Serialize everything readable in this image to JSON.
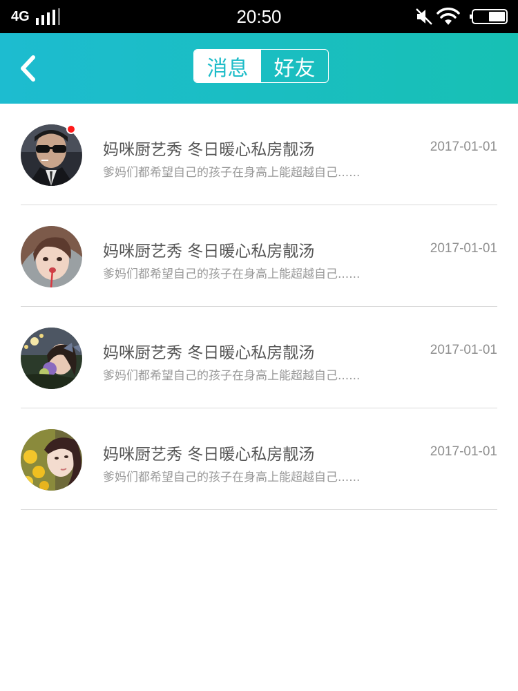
{
  "status_bar": {
    "network": "4G",
    "time": "20:50",
    "icons": [
      "signal-icon",
      "mute-icon",
      "wifi-icon",
      "battery-icon"
    ]
  },
  "header": {
    "back_icon": "chevron-left-icon",
    "tabs": [
      {
        "label": "消息",
        "active": true
      },
      {
        "label": "好友",
        "active": false
      }
    ]
  },
  "colors": {
    "header_start": "#1dbcd0",
    "header_end": "#17c0b4",
    "unread_dot": "#ff1a1a"
  },
  "messages": [
    {
      "title": "妈咪厨艺秀 冬日暖心私房靓汤",
      "date": "2017-01-01",
      "preview": "爹妈们都希望自己的孩子在身高上能超越自己......",
      "unread": true
    },
    {
      "title": "妈咪厨艺秀 冬日暖心私房靓汤",
      "date": "2017-01-01",
      "preview": "爹妈们都希望自己的孩子在身高上能超越自己......",
      "unread": false
    },
    {
      "title": "妈咪厨艺秀 冬日暖心私房靓汤",
      "date": "2017-01-01",
      "preview": "爹妈们都希望自己的孩子在身高上能超越自己......",
      "unread": false
    },
    {
      "title": "妈咪厨艺秀 冬日暖心私房靓汤",
      "date": "2017-01-01",
      "preview": "爹妈们都希望自己的孩子在身高上能超越自己......",
      "unread": false
    }
  ]
}
